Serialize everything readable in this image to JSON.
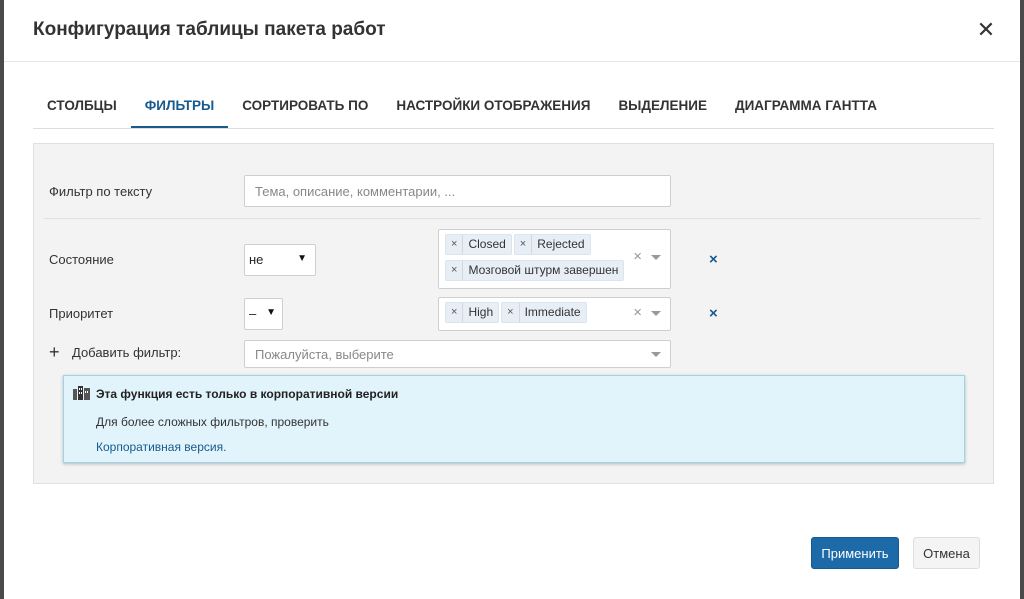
{
  "modal": {
    "title": "Конфигурация таблицы пакета работ",
    "close_icon": "close-icon"
  },
  "tabs": [
    {
      "label": "СТОЛБЦЫ",
      "active": false
    },
    {
      "label": "ФИЛЬТРЫ",
      "active": true
    },
    {
      "label": "СОРТИРОВАТЬ ПО",
      "active": false
    },
    {
      "label": "НАСТРОЙКИ ОТОБРАЖЕНИЯ",
      "active": false
    },
    {
      "label": "ВЫДЕЛЕНИЕ",
      "active": false
    },
    {
      "label": "ДИАГРАММА ГАНТТА",
      "active": false
    }
  ],
  "filters": {
    "text_filter": {
      "label": "Фильтр по тексту",
      "placeholder": "Тема, описание, комментарии, ...",
      "value": ""
    },
    "status": {
      "label": "Состояние",
      "operator": "не",
      "values": [
        "Closed",
        "Rejected",
        "Мозговой штурм завершен"
      ]
    },
    "priority": {
      "label": "Приоритет",
      "operator": "–",
      "values": [
        "High",
        "Immediate"
      ]
    },
    "add_filter": {
      "label": "Добавить фильтр:",
      "placeholder": "Пожалуйста, выберите"
    }
  },
  "notice": {
    "title": "Эта функция есть только в корпоративной версии",
    "text": "Для более сложных фильтров, проверить",
    "link": "Корпоративная версия."
  },
  "footer": {
    "apply_label": "Применить",
    "cancel_label": "Отмена"
  },
  "colors": {
    "accent": "#175a8e",
    "primary_button": "#1d6aa8",
    "notice_bg": "#e1f4fc"
  }
}
